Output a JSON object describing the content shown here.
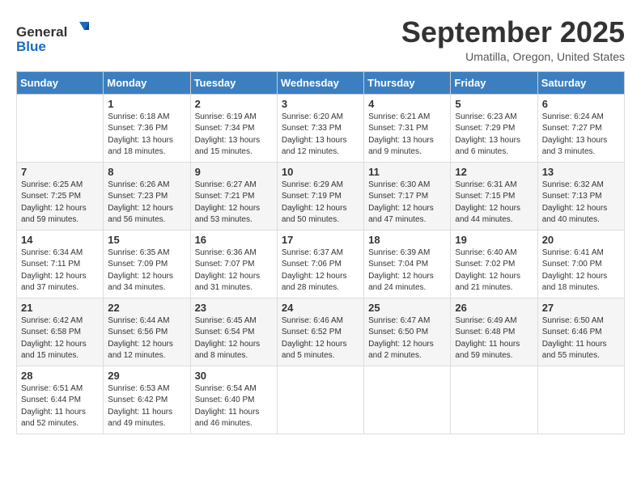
{
  "header": {
    "logo_general": "General",
    "logo_blue": "Blue",
    "month_title": "September 2025",
    "subtitle": "Umatilla, Oregon, United States"
  },
  "days_of_week": [
    "Sunday",
    "Monday",
    "Tuesday",
    "Wednesday",
    "Thursday",
    "Friday",
    "Saturday"
  ],
  "weeks": [
    [
      {
        "day": "",
        "info": ""
      },
      {
        "day": "1",
        "info": "Sunrise: 6:18 AM\nSunset: 7:36 PM\nDaylight: 13 hours\nand 18 minutes."
      },
      {
        "day": "2",
        "info": "Sunrise: 6:19 AM\nSunset: 7:34 PM\nDaylight: 13 hours\nand 15 minutes."
      },
      {
        "day": "3",
        "info": "Sunrise: 6:20 AM\nSunset: 7:33 PM\nDaylight: 13 hours\nand 12 minutes."
      },
      {
        "day": "4",
        "info": "Sunrise: 6:21 AM\nSunset: 7:31 PM\nDaylight: 13 hours\nand 9 minutes."
      },
      {
        "day": "5",
        "info": "Sunrise: 6:23 AM\nSunset: 7:29 PM\nDaylight: 13 hours\nand 6 minutes."
      },
      {
        "day": "6",
        "info": "Sunrise: 6:24 AM\nSunset: 7:27 PM\nDaylight: 13 hours\nand 3 minutes."
      }
    ],
    [
      {
        "day": "7",
        "info": "Sunrise: 6:25 AM\nSunset: 7:25 PM\nDaylight: 12 hours\nand 59 minutes."
      },
      {
        "day": "8",
        "info": "Sunrise: 6:26 AM\nSunset: 7:23 PM\nDaylight: 12 hours\nand 56 minutes."
      },
      {
        "day": "9",
        "info": "Sunrise: 6:27 AM\nSunset: 7:21 PM\nDaylight: 12 hours\nand 53 minutes."
      },
      {
        "day": "10",
        "info": "Sunrise: 6:29 AM\nSunset: 7:19 PM\nDaylight: 12 hours\nand 50 minutes."
      },
      {
        "day": "11",
        "info": "Sunrise: 6:30 AM\nSunset: 7:17 PM\nDaylight: 12 hours\nand 47 minutes."
      },
      {
        "day": "12",
        "info": "Sunrise: 6:31 AM\nSunset: 7:15 PM\nDaylight: 12 hours\nand 44 minutes."
      },
      {
        "day": "13",
        "info": "Sunrise: 6:32 AM\nSunset: 7:13 PM\nDaylight: 12 hours\nand 40 minutes."
      }
    ],
    [
      {
        "day": "14",
        "info": "Sunrise: 6:34 AM\nSunset: 7:11 PM\nDaylight: 12 hours\nand 37 minutes."
      },
      {
        "day": "15",
        "info": "Sunrise: 6:35 AM\nSunset: 7:09 PM\nDaylight: 12 hours\nand 34 minutes."
      },
      {
        "day": "16",
        "info": "Sunrise: 6:36 AM\nSunset: 7:07 PM\nDaylight: 12 hours\nand 31 minutes."
      },
      {
        "day": "17",
        "info": "Sunrise: 6:37 AM\nSunset: 7:06 PM\nDaylight: 12 hours\nand 28 minutes."
      },
      {
        "day": "18",
        "info": "Sunrise: 6:39 AM\nSunset: 7:04 PM\nDaylight: 12 hours\nand 24 minutes."
      },
      {
        "day": "19",
        "info": "Sunrise: 6:40 AM\nSunset: 7:02 PM\nDaylight: 12 hours\nand 21 minutes."
      },
      {
        "day": "20",
        "info": "Sunrise: 6:41 AM\nSunset: 7:00 PM\nDaylight: 12 hours\nand 18 minutes."
      }
    ],
    [
      {
        "day": "21",
        "info": "Sunrise: 6:42 AM\nSunset: 6:58 PM\nDaylight: 12 hours\nand 15 minutes."
      },
      {
        "day": "22",
        "info": "Sunrise: 6:44 AM\nSunset: 6:56 PM\nDaylight: 12 hours\nand 12 minutes."
      },
      {
        "day": "23",
        "info": "Sunrise: 6:45 AM\nSunset: 6:54 PM\nDaylight: 12 hours\nand 8 minutes."
      },
      {
        "day": "24",
        "info": "Sunrise: 6:46 AM\nSunset: 6:52 PM\nDaylight: 12 hours\nand 5 minutes."
      },
      {
        "day": "25",
        "info": "Sunrise: 6:47 AM\nSunset: 6:50 PM\nDaylight: 12 hours\nand 2 minutes."
      },
      {
        "day": "26",
        "info": "Sunrise: 6:49 AM\nSunset: 6:48 PM\nDaylight: 11 hours\nand 59 minutes."
      },
      {
        "day": "27",
        "info": "Sunrise: 6:50 AM\nSunset: 6:46 PM\nDaylight: 11 hours\nand 55 minutes."
      }
    ],
    [
      {
        "day": "28",
        "info": "Sunrise: 6:51 AM\nSunset: 6:44 PM\nDaylight: 11 hours\nand 52 minutes."
      },
      {
        "day": "29",
        "info": "Sunrise: 6:53 AM\nSunset: 6:42 PM\nDaylight: 11 hours\nand 49 minutes."
      },
      {
        "day": "30",
        "info": "Sunrise: 6:54 AM\nSunset: 6:40 PM\nDaylight: 11 hours\nand 46 minutes."
      },
      {
        "day": "",
        "info": ""
      },
      {
        "day": "",
        "info": ""
      },
      {
        "day": "",
        "info": ""
      },
      {
        "day": "",
        "info": ""
      }
    ]
  ]
}
